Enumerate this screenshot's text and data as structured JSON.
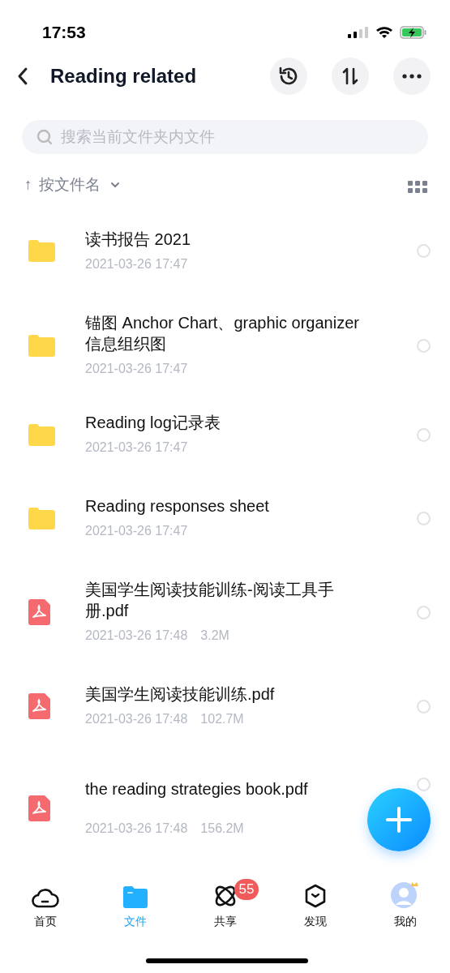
{
  "status_bar": {
    "time": "17:53"
  },
  "header": {
    "title": "Reading related"
  },
  "search": {
    "placeholder": "搜索当前文件夹内文件"
  },
  "sort": {
    "arrow": "↑",
    "label": "按文件名"
  },
  "files": [
    {
      "kind": "folder",
      "name": "读书报告 2021",
      "date": "2021-03-26 17:47",
      "selected": false
    },
    {
      "kind": "folder",
      "name": "锚图 Anchor Chart、graphic organizer信息组织图",
      "date": "2021-03-26 17:47",
      "selected": false
    },
    {
      "kind": "folder",
      "name": "Reading log记录表",
      "date": "2021-03-26 17:47",
      "selected": false
    },
    {
      "kind": "folder",
      "name": "Reading responses sheet",
      "date": "2021-03-26 17:47",
      "selected": false
    },
    {
      "kind": "pdf",
      "name": "美国学生阅读技能训练-阅读工具手册.pdf",
      "date": "2021-03-26 17:48",
      "size": "3.2M",
      "selected": false
    },
    {
      "kind": "pdf",
      "name": "美国学生阅读技能训练.pdf",
      "date": "2021-03-26 17:48",
      "size": "102.7M",
      "selected": false
    },
    {
      "kind": "pdf",
      "name": "the reading strategies book.pdf",
      "date": "2021-03-26 17:48",
      "size": "156.2M",
      "selected": false
    }
  ],
  "tab_bar": [
    {
      "kind": "home",
      "label": "首页",
      "selected": false
    },
    {
      "kind": "files",
      "label": "文件",
      "selected": true
    },
    {
      "kind": "share",
      "label": "共享",
      "selected": false,
      "badge": "55"
    },
    {
      "kind": "discover",
      "label": "发现",
      "selected": false
    },
    {
      "kind": "me",
      "label": "我的",
      "selected": false
    }
  ]
}
